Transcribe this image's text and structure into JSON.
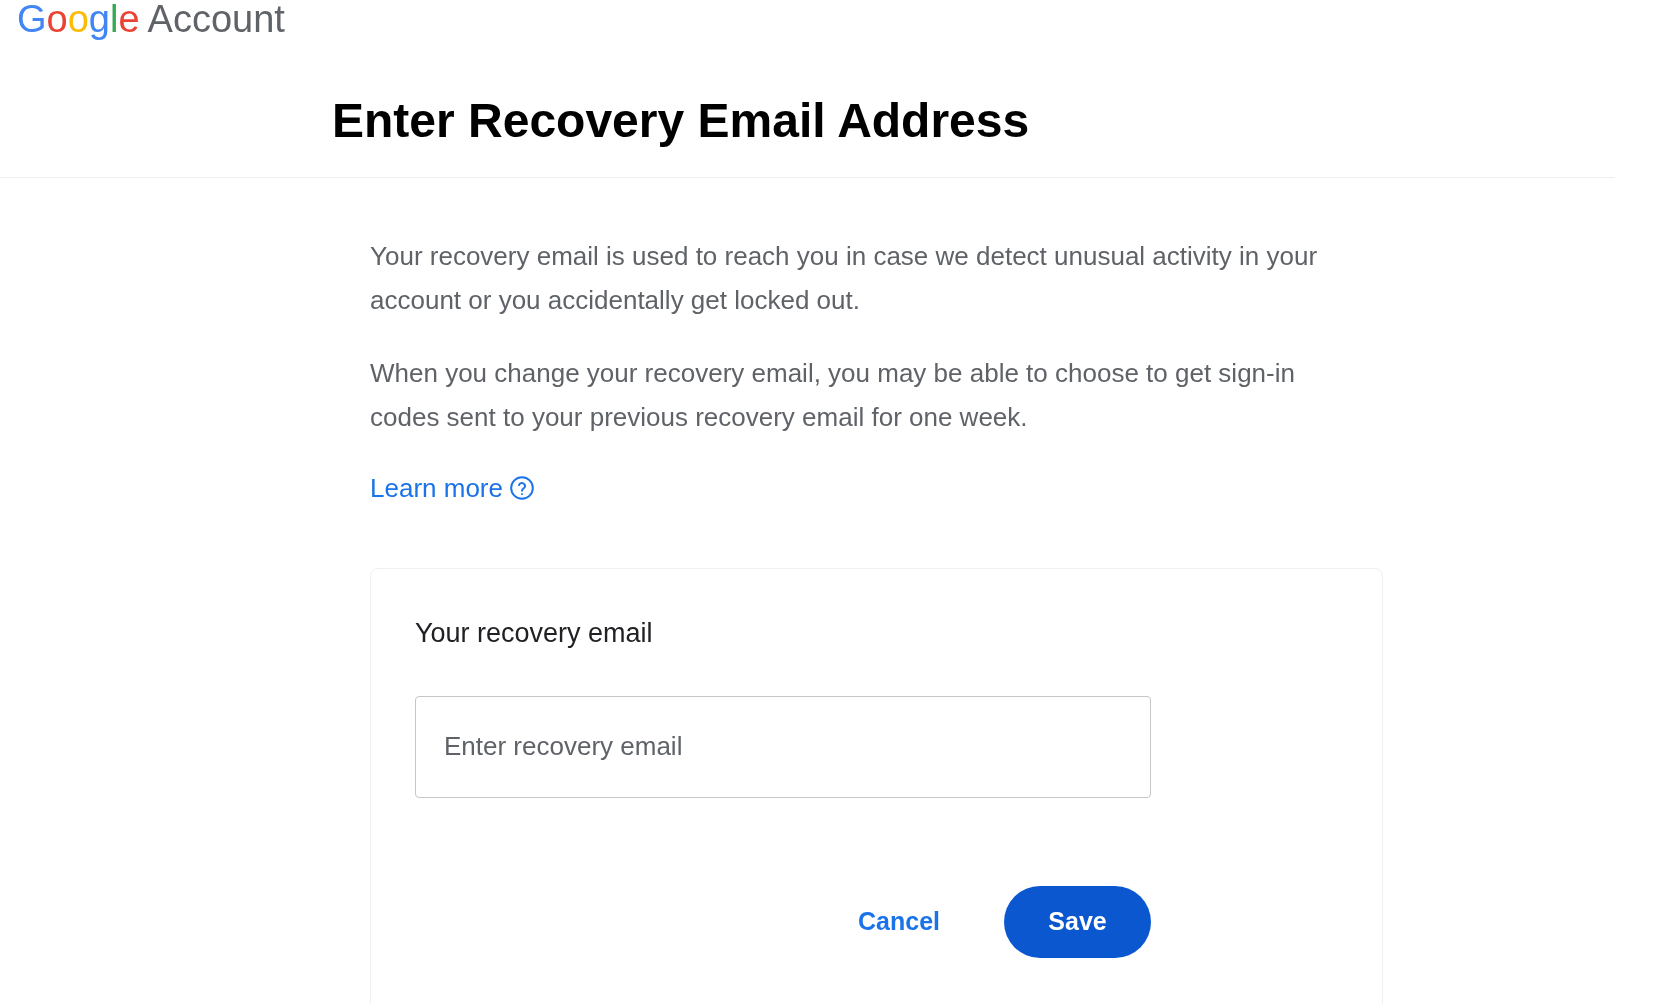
{
  "header": {
    "logo_letters": [
      {
        "char": "G",
        "color": "#4285f4"
      },
      {
        "char": "o",
        "color": "#ea4335"
      },
      {
        "char": "o",
        "color": "#fbbc05"
      },
      {
        "char": "g",
        "color": "#4285f4"
      },
      {
        "char": "l",
        "color": "#34a853"
      },
      {
        "char": "e",
        "color": "#ea4335"
      }
    ],
    "product": "Account"
  },
  "title": "Enter Recovery Email Address",
  "paragraphs": [
    "Your recovery email is used to reach you in case we detect unusual activity in your account or you accidentally get locked out.",
    "When you change your recovery email, you may be able to choose to get sign-in codes sent to your previous recovery email for one week."
  ],
  "learn_more": "Learn more",
  "card": {
    "label": "Your recovery email",
    "placeholder": "Enter recovery email",
    "cancel": "Cancel",
    "save": "Save"
  }
}
